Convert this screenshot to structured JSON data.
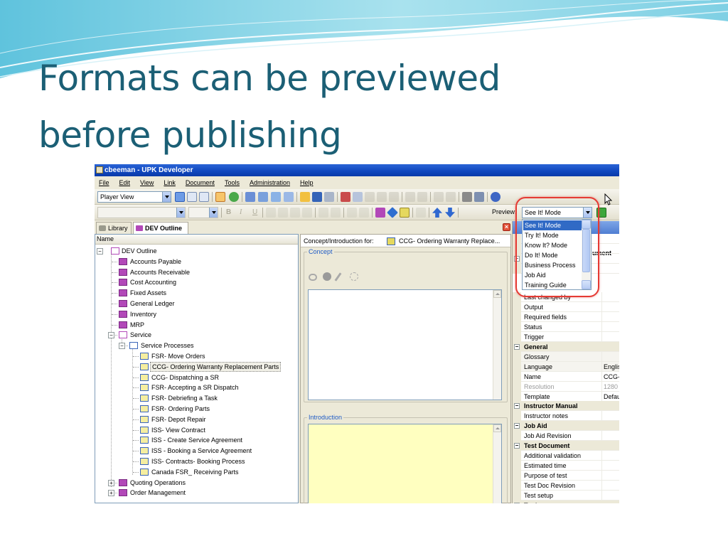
{
  "slide": {
    "title_line1": "Formats can be previewed",
    "title_line2": "before publishing"
  },
  "window": {
    "title": "cbeeman - UPK Developer"
  },
  "menu": [
    "File",
    "Edit",
    "View",
    "Link",
    "Document",
    "Tools",
    "Administration",
    "Help"
  ],
  "toolbar": {
    "view_select": "Player View",
    "preview_label": "Preview:",
    "preview_select": "See It! Mode",
    "bold": "B",
    "italic": "I",
    "underline": "U"
  },
  "tabs": {
    "library": "Library",
    "outline": "DEV Outline"
  },
  "tree": {
    "column_header": "Name",
    "root": "DEV Outline",
    "items": [
      "Accounts Payable",
      "Accounts Receivable",
      "Cost Accounting",
      "Fixed Assets",
      "General Ledger",
      "Inventory",
      "MRP",
      "Service",
      "Service Processes",
      "FSR- Move Orders",
      "CCG- Ordering Warranty Replacement Parts",
      "CCG- Dispatching a SR",
      "FSR- Accepting a SR Dispatch",
      "FSR- Debriefing a Task",
      "FSR- Ordering Parts",
      "FSR- Depot Repair",
      "ISS- View Contract",
      "ISS - Create Service Agreement",
      "ISS - Booking a Service Agreement",
      "ISS- Contracts- Booking Process",
      "Canada FSR_ Receiving Parts",
      "Quoting Operations",
      "Order Management"
    ]
  },
  "concept_pane": {
    "header_label": "Concept/Introduction for:",
    "header_doc": "CCG- Ordering Warranty Replace...",
    "concept_legend": "Concept",
    "intro_legend": "Introduction"
  },
  "preview_options": [
    "See It! Mode",
    "Try It! Mode",
    "Know It? Mode",
    "Do It! Mode",
    "Business Process",
    "Job Aid",
    "Training Guide"
  ],
  "properties": {
    "header_fragment": "ument",
    "rows": [
      {
        "name": "Last changed by",
        "value": ""
      },
      {
        "name": "Output",
        "value": ""
      },
      {
        "name": "Required fields",
        "value": ""
      },
      {
        "name": "Status",
        "value": ""
      },
      {
        "name": "Trigger",
        "value": ""
      },
      {
        "name": "General",
        "value": "",
        "category": true
      },
      {
        "name": "Glossary",
        "value": ""
      },
      {
        "name": "Language",
        "value": "Englisl"
      },
      {
        "name": "Name",
        "value": "CCG-"
      },
      {
        "name": "Resolution",
        "value": "1280 ;"
      },
      {
        "name": "Template",
        "value": "Defau"
      },
      {
        "name": "Instructor Manual",
        "value": "",
        "category": true
      },
      {
        "name": "Instructor notes",
        "value": ""
      },
      {
        "name": "Job Aid",
        "value": "",
        "category": true
      },
      {
        "name": "Job Aid Revision",
        "value": ""
      },
      {
        "name": "Test Document",
        "value": "",
        "category": true
      },
      {
        "name": "Additional validation",
        "value": ""
      },
      {
        "name": "Estimated time",
        "value": ""
      },
      {
        "name": "Purpose of test",
        "value": ""
      },
      {
        "name": "Test Doc Revision",
        "value": ""
      },
      {
        "name": "Test setup",
        "value": ""
      },
      {
        "name": "Topic",
        "value": "",
        "category": true
      }
    ]
  },
  "colors": {
    "title_text": "#1b5f75",
    "titlebar": "#0f46bd",
    "highlight": "#316ac5",
    "intro_fill": "#ffffc0",
    "annotation": "#e53a33"
  }
}
